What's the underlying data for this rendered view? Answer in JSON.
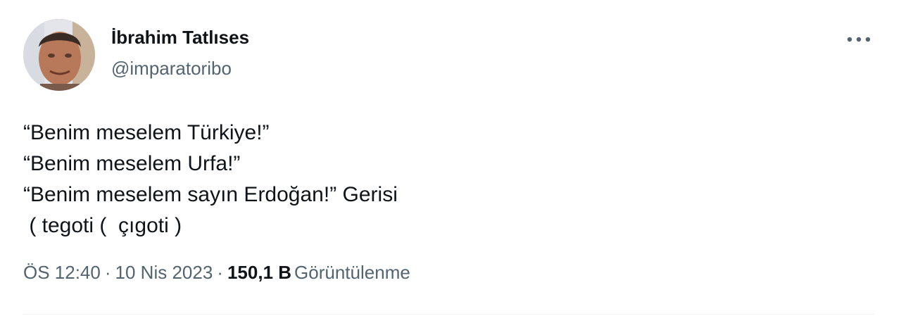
{
  "author": {
    "display_name": "İbrahim Tatlıses",
    "handle": "@imparatoribo"
  },
  "tweet": {
    "lines": [
      "“Benim meselem Türkiye!”",
      "“Benim meselem Urfa!”",
      "“Benim meselem sayın Erdoğan!” Gerisi",
      " ( tegoti (  çıgoti )"
    ]
  },
  "meta": {
    "time": "ÖS 12:40",
    "separator": "·",
    "date": "10 Nis 2023",
    "views_count": "150,1 B",
    "views_label": "Görüntülenme"
  },
  "icons": {
    "more": "more-horizontal-icon",
    "avatar": "user-avatar"
  },
  "colors": {
    "text_primary": "#0f1419",
    "text_secondary": "#536471",
    "divider": "#eff3f4"
  }
}
